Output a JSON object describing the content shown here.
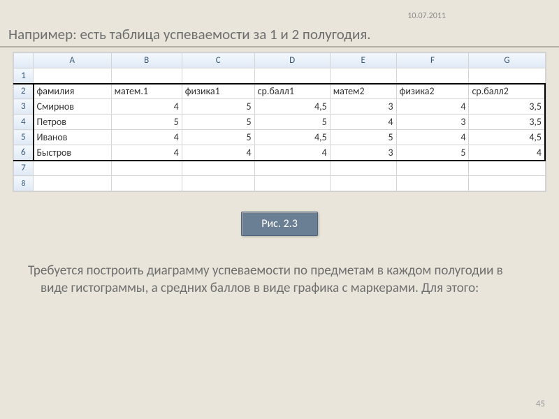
{
  "date": "10.07.2011",
  "title": "Например: есть таблица успеваемости за 1 и 2 полугодия.",
  "columns": [
    "A",
    "B",
    "C",
    "D",
    "E",
    "F",
    "G"
  ],
  "row_labels": [
    "1",
    "2",
    "3",
    "4",
    "5",
    "6",
    "7",
    "8"
  ],
  "header_row": [
    "фамилия",
    "матем.1",
    "физика1",
    "ср.балл1",
    "матем2",
    "физика2",
    "ср.балл2"
  ],
  "data_rows": [
    {
      "name": "Смирнов",
      "m1": "4",
      "p1": "5",
      "a1": "4,5",
      "m2": "3",
      "p2": "4",
      "a2": "3,5"
    },
    {
      "name": "Петров",
      "m1": "5",
      "p1": "5",
      "a1": "5",
      "m2": "4",
      "p2": "3",
      "a2": "3,5"
    },
    {
      "name": "Иванов",
      "m1": "4",
      "p1": "5",
      "a1": "4,5",
      "m2": "5",
      "p2": "4",
      "a2": "4,5"
    },
    {
      "name": "Быстров",
      "m1": "4",
      "p1": "4",
      "a1": "4",
      "m2": "3",
      "p2": "5",
      "a2": "4"
    }
  ],
  "caption": "Рис. 2.3",
  "body": "Требуется построить диаграмму успеваемости по предметам в каждом полугодии в виде гистограммы, а средних баллов в виде графика с маркерами. Для этого:",
  "page": "45"
}
